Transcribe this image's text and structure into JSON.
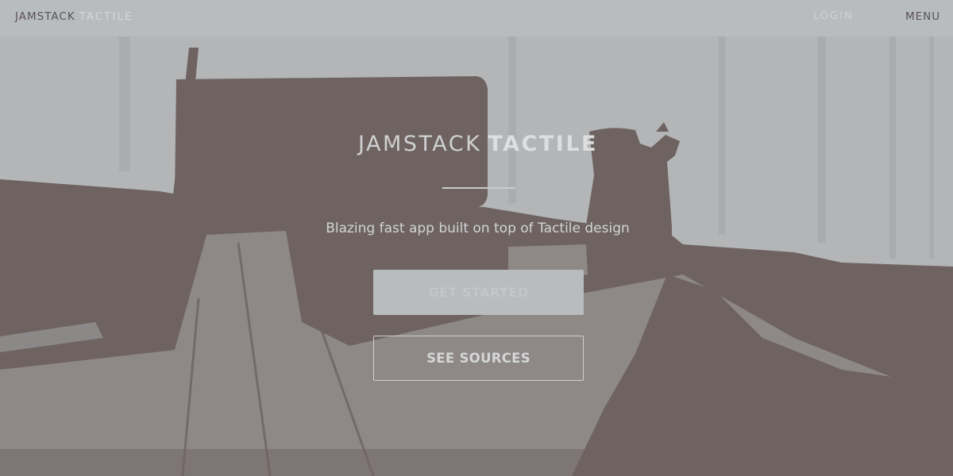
{
  "header": {
    "brand_primary": "JAMSTACK",
    "brand_secondary": "TACTILE",
    "login_label": "LOGIN",
    "menu_label": "MENU"
  },
  "hero": {
    "title_regular": "JAMSTACK",
    "title_bold": "TACTILE",
    "tagline": "Blazing fast app built on top of Tactile design",
    "primary_button_label": "GET STARTED",
    "secondary_button_label": "SEE SOURCES"
  },
  "colors": {
    "header_background": "#b9bcbd",
    "hero_dark": "#6e6361",
    "hero_light": "#b9bcbd",
    "text_light": "#cfd1d2",
    "text_dark": "#5a5256"
  }
}
